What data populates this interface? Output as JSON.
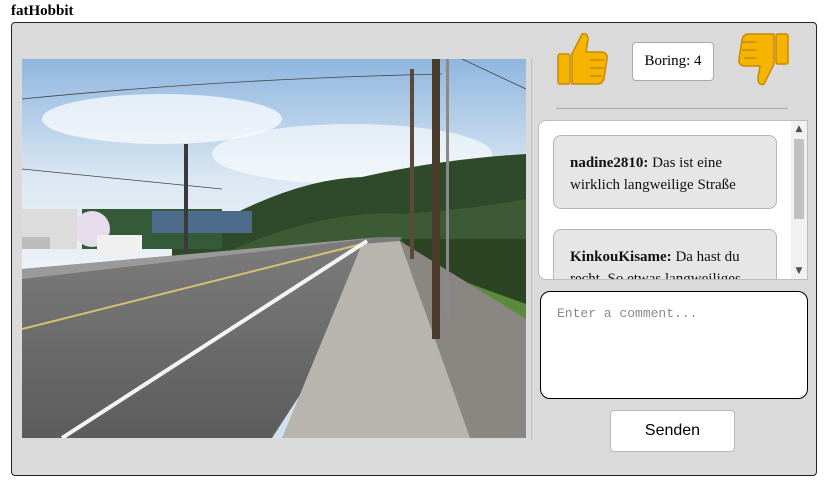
{
  "user": {
    "name": "fatHobbit"
  },
  "rating": {
    "label": "Boring: 4"
  },
  "icons": {
    "like": "thumbs-up-icon",
    "dislike": "thumbs-down-icon",
    "thumb_color": "#f5b400"
  },
  "image": {
    "description": "Street with sidewalk, utility poles and hills"
  },
  "comments": [
    {
      "author": "nadine2810:",
      "text": "Das ist eine wirklich langweilige Straße"
    },
    {
      "author": "KinkouKisame:",
      "text": "Da hast du recht. So etwas langweiliges"
    }
  ],
  "comment_input": {
    "placeholder": "Enter a comment...",
    "value": ""
  },
  "send_button": {
    "label": "Senden"
  }
}
